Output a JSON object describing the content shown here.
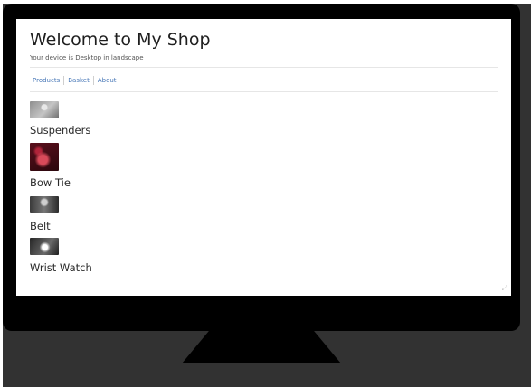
{
  "header": {
    "title": "Welcome to My Shop",
    "subtitle": "Your device is Desktop in landscape"
  },
  "nav": {
    "items": [
      {
        "label": "Products"
      },
      {
        "label": "Basket"
      },
      {
        "label": "About"
      }
    ]
  },
  "products": [
    {
      "name": "Suspenders",
      "thumbnail": "suspenders-photo"
    },
    {
      "name": "Bow Tie",
      "thumbnail": "bow-tie-photo"
    },
    {
      "name": "Belt",
      "thumbnail": "belt-photo"
    },
    {
      "name": "Wrist Watch",
      "thumbnail": "wrist-watch-photo"
    }
  ],
  "device": {
    "frame": "monitor",
    "resize_icon": "resize-icon"
  },
  "colors": {
    "link": "#4a79b8",
    "text": "#1e1e1e",
    "monitor": "#000000",
    "background": "#323232"
  }
}
